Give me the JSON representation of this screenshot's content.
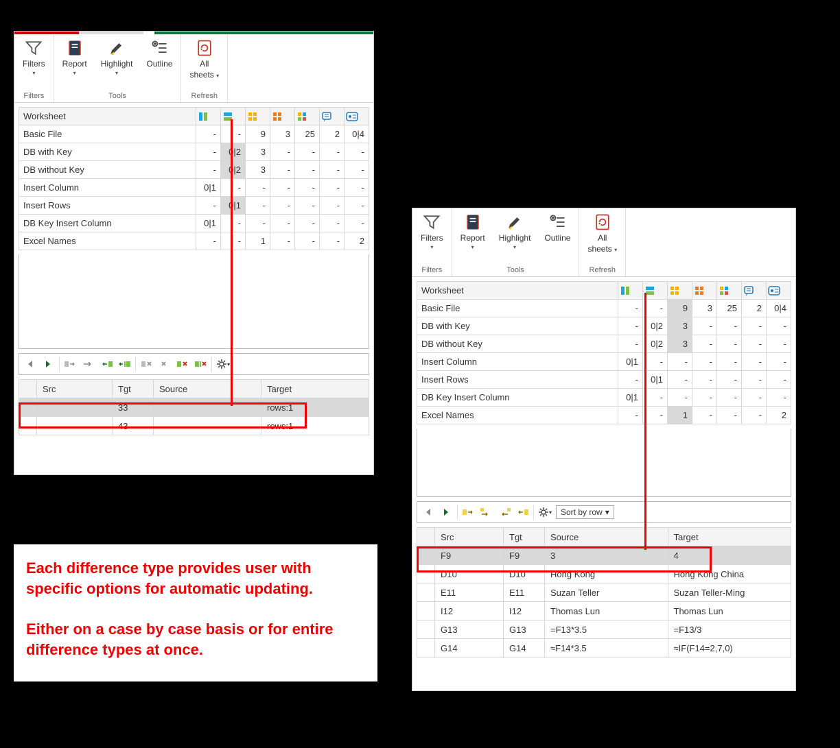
{
  "ribbon": {
    "filters": "Filters",
    "report": "Report",
    "highlight": "Highlight",
    "outline": "Outline",
    "allsheets_l1": "All",
    "allsheets_l2": "sheets",
    "group_filters": "Filters",
    "group_tools": "Tools",
    "group_refresh": "Refresh"
  },
  "ws_header": "Worksheet",
  "ws_rows": [
    {
      "name": "Basic File",
      "c": [
        "-",
        "-",
        "9",
        "3",
        "25",
        "2",
        "0|4"
      ]
    },
    {
      "name": "DB with Key",
      "c": [
        "-",
        "0|2",
        "3",
        "-",
        "-",
        "-",
        "-"
      ]
    },
    {
      "name": "DB without Key",
      "c": [
        "-",
        "0|2",
        "3",
        "-",
        "-",
        "-",
        "-"
      ]
    },
    {
      "name": "Insert Column",
      "c": [
        "0|1",
        "-",
        "-",
        "-",
        "-",
        "-",
        "-"
      ]
    },
    {
      "name": "Insert Rows",
      "c": [
        "-",
        "0|1",
        "-",
        "-",
        "-",
        "-",
        "-"
      ]
    },
    {
      "name": "DB Key Insert Column",
      "c": [
        "0|1",
        "-",
        "-",
        "-",
        "-",
        "-",
        "-"
      ]
    },
    {
      "name": "Excel Names",
      "c": [
        "-",
        "-",
        "1",
        "-",
        "-",
        "-",
        "2"
      ]
    }
  ],
  "detail_left": {
    "headers": {
      "blank": "",
      "src": "Src",
      "tgt": "Tgt",
      "source": "Source",
      "target": "Target"
    },
    "rows": [
      {
        "src": "",
        "tgt": "33",
        "source": "",
        "target": "rows:1",
        "sel": true
      },
      {
        "src": "",
        "tgt": "43",
        "source": "",
        "target": "rows:1"
      }
    ]
  },
  "detail_right": {
    "headers": {
      "blank": "",
      "src": "Src",
      "tgt": "Tgt",
      "source": "Source",
      "target": "Target"
    },
    "sort_label": "Sort by row",
    "rows": [
      {
        "src": "F9",
        "tgt": "F9",
        "source": "3",
        "target": "4",
        "sel": true
      },
      {
        "src": "D10",
        "tgt": "D10",
        "source": "Hong Kong",
        "target": "Hong Kong China"
      },
      {
        "src": "E11",
        "tgt": "E11",
        "source": "Suzan Teller",
        "target": "Suzan Teller-Ming"
      },
      {
        "src": "I12",
        "tgt": "I12",
        "source": "Thomas Lun",
        "target": "Thomas Lun"
      },
      {
        "src": "G13",
        "tgt": "G13",
        "source": "=F13*3.5",
        "target": "=F13/3"
      },
      {
        "src": "G14",
        "tgt": "G14",
        "source": "≈F14*3.5",
        "target": "≈IF(F14=2,7,0)"
      }
    ]
  },
  "annotation": {
    "p1": "Each difference type provides user with specific options for automatic updating.",
    "p2": "Either on a case by case basis or for entire difference types at once."
  }
}
